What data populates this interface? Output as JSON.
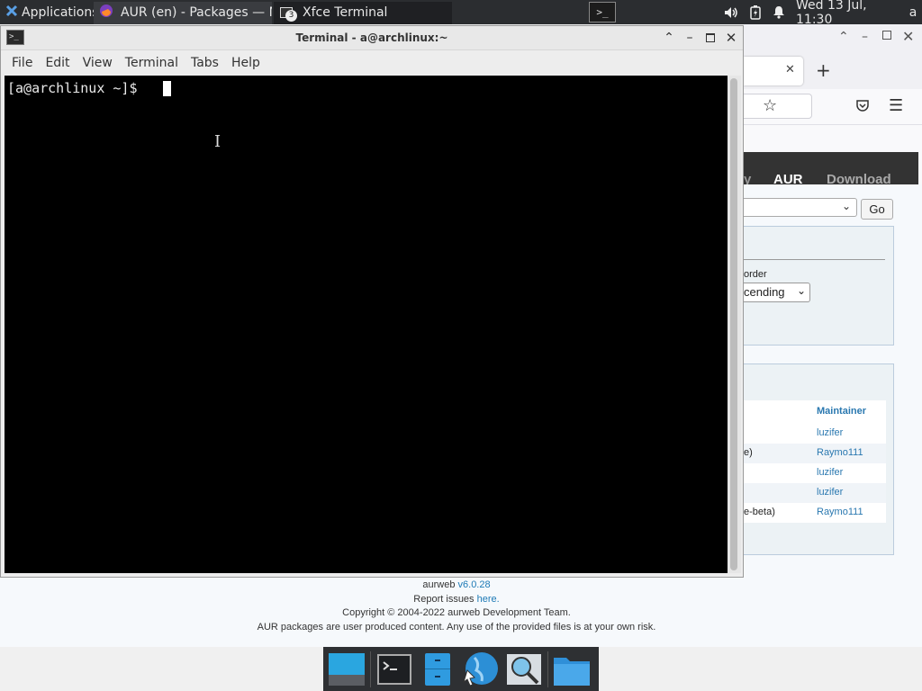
{
  "panel": {
    "applications_label": "Applications",
    "tasks": [
      {
        "label": "AUR (en) - Packages — M..."
      },
      {
        "label": "Xfce Terminal",
        "badge": "3"
      }
    ],
    "clock": "Wed 13 Jul, 11:30",
    "user_initial": "a"
  },
  "terminal": {
    "title": "Terminal - a@archlinux:~",
    "menu": [
      "File",
      "Edit",
      "View",
      "Terminal",
      "Tabs",
      "Help"
    ],
    "prompt": "[a@archlinux ~]$ "
  },
  "browser": {
    "nav": {
      "aur": "AUR",
      "download": "Download",
      "partial": "y"
    },
    "go_label": "Go",
    "order_label": "order",
    "order_value": "cending",
    "maintainer_header": "Maintainer",
    "rows": [
      {
        "desc": "",
        "maintainer": "luzifer"
      },
      {
        "desc": "e)",
        "maintainer": "Raymo111"
      },
      {
        "desc": "",
        "maintainer": "luzifer"
      },
      {
        "desc": "",
        "maintainer": "luzifer"
      },
      {
        "desc": "e-beta)",
        "maintainer": "Raymo111"
      }
    ]
  },
  "footer": {
    "aurweb": "aurweb",
    "version": "v6.0.28",
    "report": "Report issues",
    "here": "here.",
    "copyright": "Copyright © 2004-2022 aurweb Development Team.",
    "disclaimer": "AUR packages are user produced content. Any use of the provided files is at your own risk."
  },
  "colors": {
    "panel": "#2b2d30",
    "aur_header": "#333333",
    "link": "#1e7ab6",
    "terminal_bg": "#000000"
  }
}
